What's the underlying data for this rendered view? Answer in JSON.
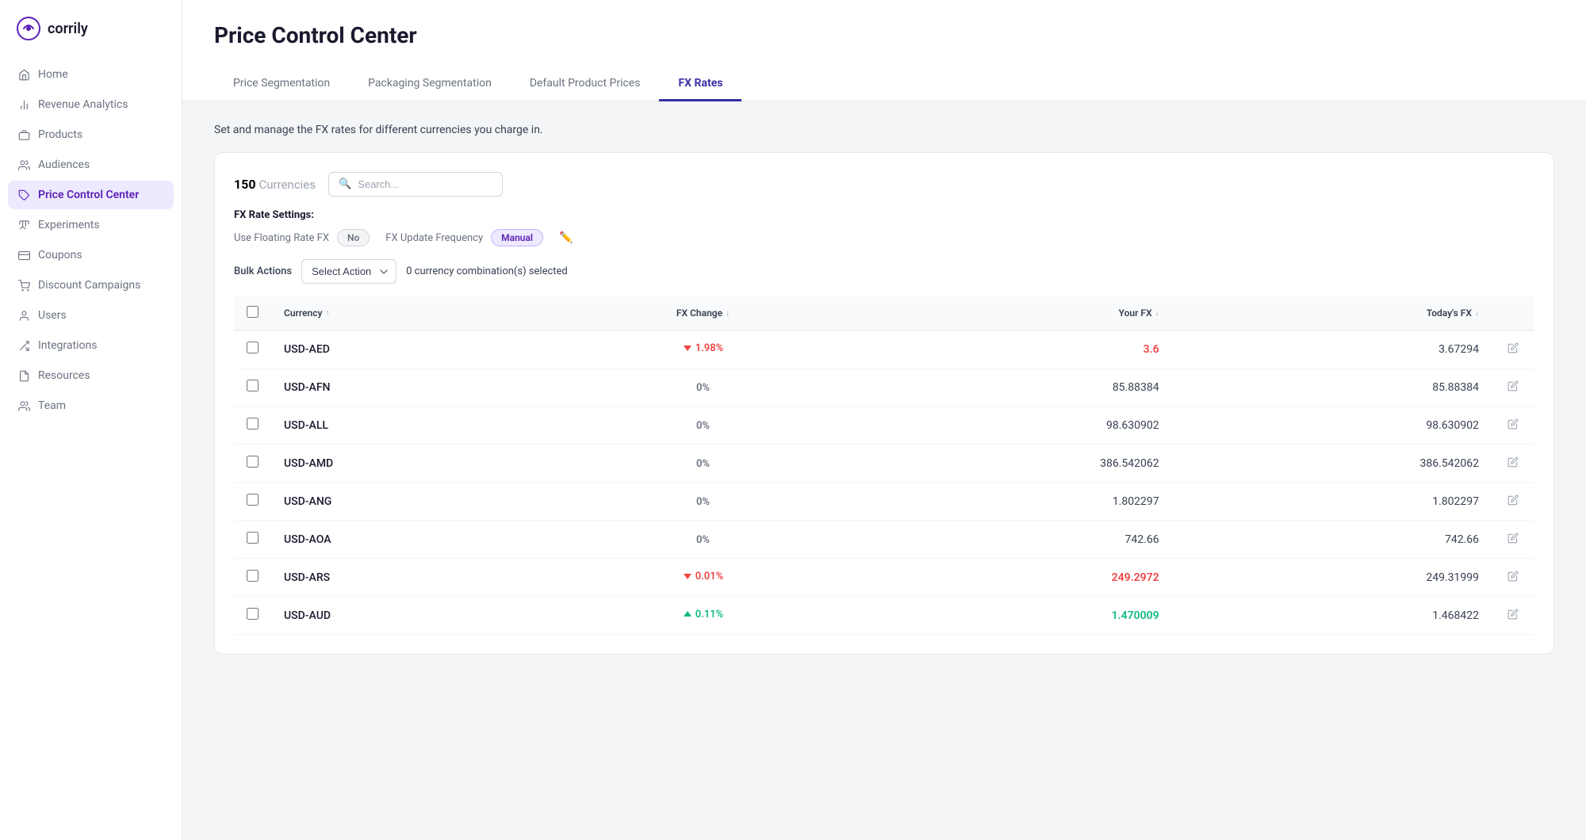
{
  "sidebar": {
    "logo": {
      "text": "corrily"
    },
    "nav_items": [
      {
        "id": "home",
        "label": "Home",
        "icon": "🏠",
        "active": false
      },
      {
        "id": "revenue-analytics",
        "label": "Revenue Analytics",
        "icon": "📈",
        "active": false
      },
      {
        "id": "products",
        "label": "Products",
        "icon": "🧩",
        "active": false
      },
      {
        "id": "audiences",
        "label": "Audiences",
        "icon": "👥",
        "active": false
      },
      {
        "id": "price-control-center",
        "label": "Price Control Center",
        "icon": "🏷️",
        "active": true
      },
      {
        "id": "experiments",
        "label": "Experiments",
        "icon": "🔬",
        "active": false
      },
      {
        "id": "coupons",
        "label": "Coupons",
        "icon": "🎟️",
        "active": false
      },
      {
        "id": "discount-campaigns",
        "label": "Discount Campaigns",
        "icon": "🏷️",
        "active": false
      },
      {
        "id": "users",
        "label": "Users",
        "icon": "👤",
        "active": false
      },
      {
        "id": "integrations",
        "label": "Integrations",
        "icon": "🔗",
        "active": false
      },
      {
        "id": "resources",
        "label": "Resources",
        "icon": "📄",
        "active": false
      },
      {
        "id": "team",
        "label": "Team",
        "icon": "🤝",
        "active": false
      }
    ]
  },
  "page": {
    "title": "Price Control Center",
    "tabs": [
      {
        "id": "price-segmentation",
        "label": "Price Segmentation",
        "active": false
      },
      {
        "id": "packaging-segmentation",
        "label": "Packaging Segmentation",
        "active": false
      },
      {
        "id": "default-product-prices",
        "label": "Default Product Prices",
        "active": false
      },
      {
        "id": "fx-rates",
        "label": "FX Rates",
        "active": true
      }
    ],
    "description": "Set and manage the FX rates for different currencies you charge in."
  },
  "fx_rates": {
    "currencies_count": "150",
    "currencies_label": "Currencies",
    "search_placeholder": "Search...",
    "settings": {
      "title": "FX Rate Settings:",
      "floating_rate_label": "Use Floating Rate FX",
      "floating_rate_value": "No",
      "update_frequency_label": "FX Update Frequency",
      "update_frequency_value": "Manual"
    },
    "bulk_actions": {
      "label": "Bulk Actions",
      "select_action_placeholder": "Select Action",
      "selected_text": "0 currency combination(s) selected"
    },
    "table": {
      "columns": [
        {
          "id": "checkbox",
          "label": ""
        },
        {
          "id": "currency",
          "label": "Currency",
          "sortable": true,
          "sort_dir": "asc"
        },
        {
          "id": "fx_change",
          "label": "FX Change",
          "sortable": true,
          "sort_dir": "desc"
        },
        {
          "id": "your_fx",
          "label": "Your FX",
          "sortable": true,
          "sort_dir": "desc"
        },
        {
          "id": "todays_fx",
          "label": "Today's FX",
          "sortable": true,
          "sort_dir": "desc"
        }
      ],
      "rows": [
        {
          "currency": "USD-AED",
          "fx_change": "1.98%",
          "fx_change_dir": "down",
          "your_fx": "3.6",
          "your_fx_colored": true,
          "todays_fx": "3.67294"
        },
        {
          "currency": "USD-AFN",
          "fx_change": "0%",
          "fx_change_dir": "neutral",
          "your_fx": "85.88384",
          "your_fx_colored": false,
          "todays_fx": "85.88384"
        },
        {
          "currency": "USD-ALL",
          "fx_change": "0%",
          "fx_change_dir": "neutral",
          "your_fx": "98.630902",
          "your_fx_colored": false,
          "todays_fx": "98.630902"
        },
        {
          "currency": "USD-AMD",
          "fx_change": "0%",
          "fx_change_dir": "neutral",
          "your_fx": "386.542062",
          "your_fx_colored": false,
          "todays_fx": "386.542062"
        },
        {
          "currency": "USD-ANG",
          "fx_change": "0%",
          "fx_change_dir": "neutral",
          "your_fx": "1.802297",
          "your_fx_colored": false,
          "todays_fx": "1.802297"
        },
        {
          "currency": "USD-AOA",
          "fx_change": "0%",
          "fx_change_dir": "neutral",
          "your_fx": "742.66",
          "your_fx_colored": false,
          "todays_fx": "742.66"
        },
        {
          "currency": "USD-ARS",
          "fx_change": "0.01%",
          "fx_change_dir": "down",
          "your_fx": "249.2972",
          "your_fx_colored": true,
          "todays_fx": "249.31999"
        },
        {
          "currency": "USD-AUD",
          "fx_change": "0.11%",
          "fx_change_dir": "up",
          "your_fx": "1.470009",
          "your_fx_colored": true,
          "todays_fx": "1.468422"
        }
      ]
    }
  }
}
